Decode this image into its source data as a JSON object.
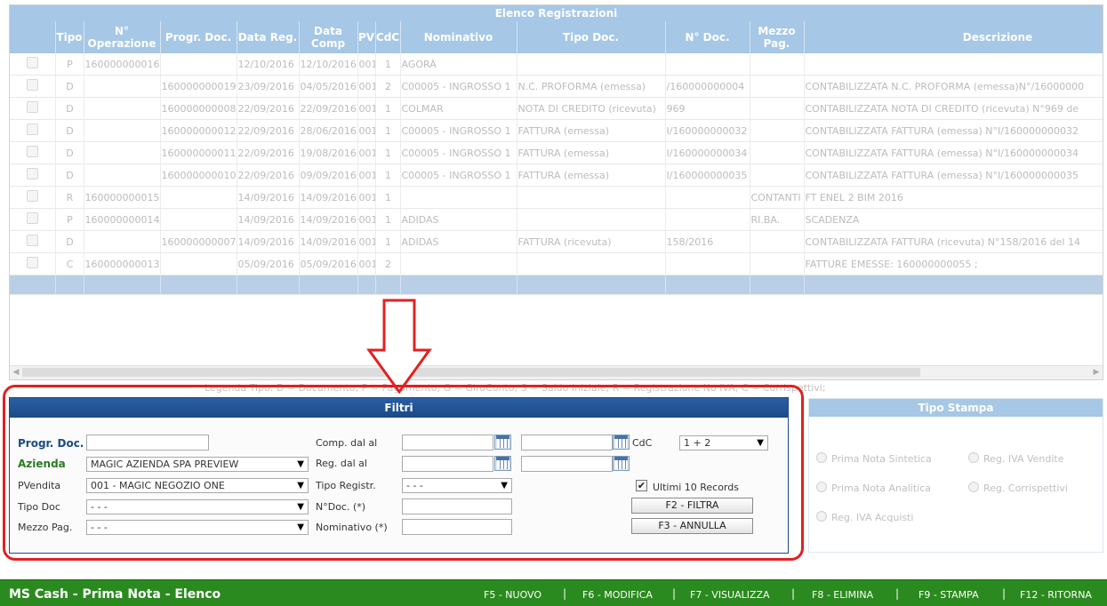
{
  "grid": {
    "title": "Elenco Registrazioni",
    "columns": [
      "",
      "Tipo",
      "N° Operazione",
      "Progr. Doc.",
      "Data Reg.",
      "Data Comp",
      "PV",
      "CdC",
      "Nominativo",
      "Tipo Doc.",
      "N° Doc.",
      "Mezzo Pag.",
      "Descrizione"
    ],
    "rows": [
      [
        "",
        "P",
        "160000000016",
        "",
        "12/10/2016",
        "12/10/2016",
        "001",
        "1",
        "AGORÀ",
        "",
        "",
        "",
        ""
      ],
      [
        "",
        "D",
        "",
        "160000000019",
        "23/09/2016",
        "04/05/2016",
        "001",
        "2",
        "C00005 - INGROSSO 1",
        "N.C. PROFORMA (emessa)",
        "/160000000004",
        "",
        "CONTABILIZZATA N.C. PROFORMA (emessa)N°/16000000"
      ],
      [
        "",
        "D",
        "",
        "160000000008",
        "22/09/2016",
        "22/09/2016",
        "001",
        "1",
        "COLMAR",
        "NOTA DI CREDITO (ricevuta)",
        "969",
        "",
        "CONTABILIZZATA NOTA DI CREDITO (ricevuta) N°969 de"
      ],
      [
        "",
        "D",
        "",
        "160000000012",
        "22/09/2016",
        "28/06/2016",
        "001",
        "1",
        "C00005 - INGROSSO 1",
        "FATTURA (emessa)",
        "I/160000000032",
        "",
        "CONTABILIZZATA FATTURA (emessa) N°I/160000000032"
      ],
      [
        "",
        "D",
        "",
        "160000000011",
        "22/09/2016",
        "19/08/2016",
        "001",
        "1",
        "C00005 - INGROSSO 1",
        "FATTURA (emessa)",
        "I/160000000034",
        "",
        "CONTABILIZZATA FATTURA (emessa) N°I/160000000034"
      ],
      [
        "",
        "D",
        "",
        "160000000010",
        "22/09/2016",
        "09/09/2016",
        "001",
        "1",
        "C00005 - INGROSSO 1",
        "FATTURA (emessa)",
        "I/160000000035",
        "",
        "CONTABILIZZATA FATTURA (emessa) N°I/160000000035"
      ],
      [
        "",
        "R",
        "160000000015",
        "",
        "14/09/2016",
        "14/09/2016",
        "001",
        "1",
        "",
        "",
        "",
        "CONTANTI",
        "FT ENEL 2 BIM 2016"
      ],
      [
        "",
        "P",
        "160000000014",
        "",
        "14/09/2016",
        "14/09/2016",
        "001",
        "1",
        "ADIDAS",
        "",
        "",
        "RI.BA.",
        "SCADENZA"
      ],
      [
        "",
        "D",
        "",
        "160000000007",
        "14/09/2016",
        "14/09/2016",
        "001",
        "1",
        "ADIDAS",
        "FATTURA (ricevuta)",
        "158/2016",
        "",
        "CONTABILIZZATA FATTURA (ricevuta) N°158/2016 del 14"
      ],
      [
        "",
        "C",
        "160000000013",
        "",
        "05/09/2016",
        "05/09/2016",
        "001",
        "2",
        "",
        "",
        "",
        "",
        "FATTURE EMESSE: 160000000055 ;"
      ]
    ]
  },
  "legend": "Legenda Tipo:   D = Documento;   P = Pagamento;   G = GiroConto;   S = Saldo Iniziale;   R = Registrazione No IVA;   C = Corrispettivi;",
  "filters": {
    "title": "Filtri",
    "progr_doc_label": "Progr. Doc.",
    "azienda_label": "Azienda",
    "azienda_value": "MAGIC AZIENDA SPA PREVIEW",
    "pvendita_label": "PVendita",
    "pvendita_value": "001 - MAGIC NEGOZIO ONE",
    "tipo_doc_label": "Tipo Doc",
    "tipo_doc_value": "- - -",
    "mezzo_pag_label": "Mezzo Pag.",
    "mezzo_pag_value": "- - -",
    "comp_label": "Comp. dal al",
    "reg_label": "Reg. dal al",
    "tipo_registr_label": "Tipo Registr.",
    "tipo_registr_value": "- - -",
    "ndoc_label": "N°Doc. (*)",
    "nominativo_label": "Nominativo (*)",
    "cdc_label": "CdC",
    "cdc_value": "1 + 2",
    "ultimi_label": "Ultimi 10 Records",
    "ultimi_checked": true,
    "filtra_label": "F2 - FILTRA",
    "annulla_label": "F3 - ANNULLA"
  },
  "print": {
    "title": "Tipo Stampa",
    "options": [
      "Prima Nota Sintetica",
      "Reg. IVA Vendite",
      "Prima Nota Analitica",
      "Reg. Corrispettivi",
      "Reg. IVA Acquisti"
    ]
  },
  "bottom": {
    "app_title": "MS Cash - Prima Nota - Elenco",
    "keys": [
      "F5 - NUOVO",
      "F6 - MODIFICA",
      "F7 - VISUALIZZA",
      "F8 - ELIMINA",
      "F9 - STAMPA",
      "F12 - RITORNA"
    ],
    "separator": "|"
  },
  "colors": {
    "accent": "#e32020",
    "header": "#a6c7e6",
    "filter_header": "#1c4a86",
    "bottom_bar": "#2b8a1f"
  }
}
